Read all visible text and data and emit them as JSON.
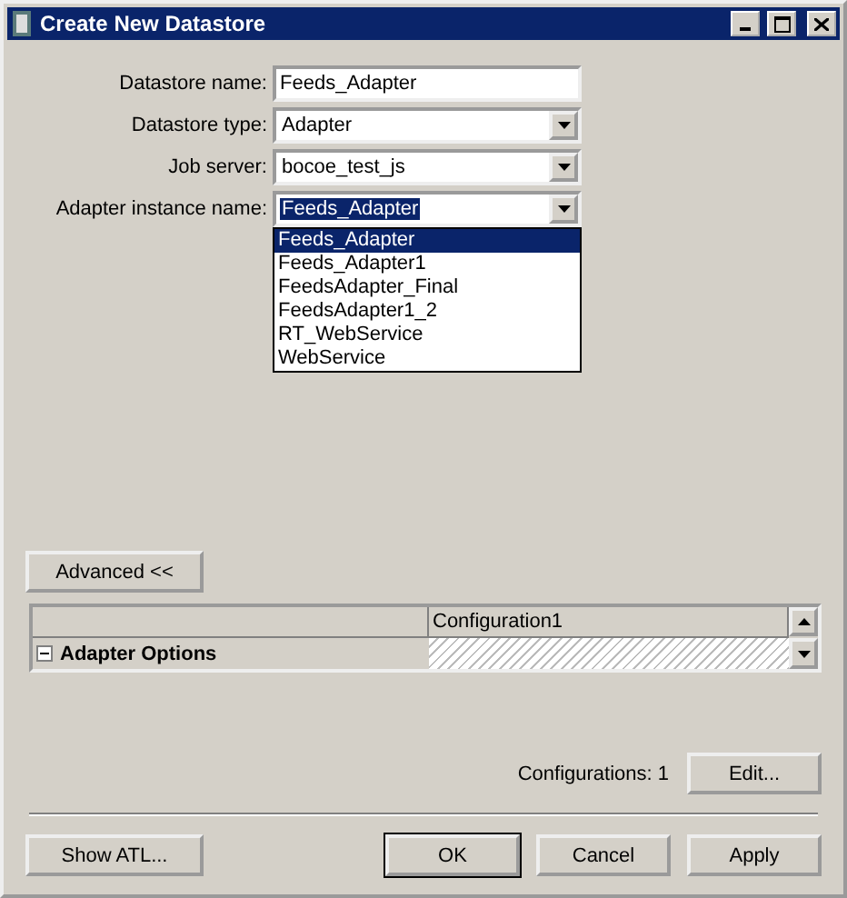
{
  "window": {
    "title": "Create New Datastore"
  },
  "form": [
    {
      "label": "Datastore name:",
      "kind": "text",
      "value": "Feeds_Adapter"
    },
    {
      "label": "Datastore type:",
      "kind": "combo",
      "value": "Adapter",
      "highlighted": false
    },
    {
      "label": "Job server:",
      "kind": "combo",
      "value": "bocoe_test_js",
      "highlighted": false
    },
    {
      "label": "Adapter instance name:",
      "kind": "combo",
      "value": "Feeds_Adapter",
      "highlighted": true
    }
  ],
  "dropdown": [
    {
      "label": "Feeds_Adapter",
      "selected": true
    },
    {
      "label": "Feeds_Adapter1",
      "selected": false
    },
    {
      "label": "FeedsAdapter_Final",
      "selected": false
    },
    {
      "label": "FeedsAdapter1_2",
      "selected": false
    },
    {
      "label": "RT_WebService",
      "selected": false
    },
    {
      "label": "WebService",
      "selected": false
    }
  ],
  "advanced_button": "Advanced <<",
  "table": {
    "columns": [
      "Configuration1"
    ],
    "rows": [
      {
        "label": "Adapter Options",
        "expanded": true
      }
    ]
  },
  "configurations": "Configurations: 1",
  "edit_button": "Edit...",
  "buttons": [
    {
      "label": "Show ATL...",
      "default": false
    },
    {
      "label": "OK",
      "default": true
    },
    {
      "label": "Cancel",
      "default": false
    },
    {
      "label": "Apply",
      "default": false
    }
  ]
}
